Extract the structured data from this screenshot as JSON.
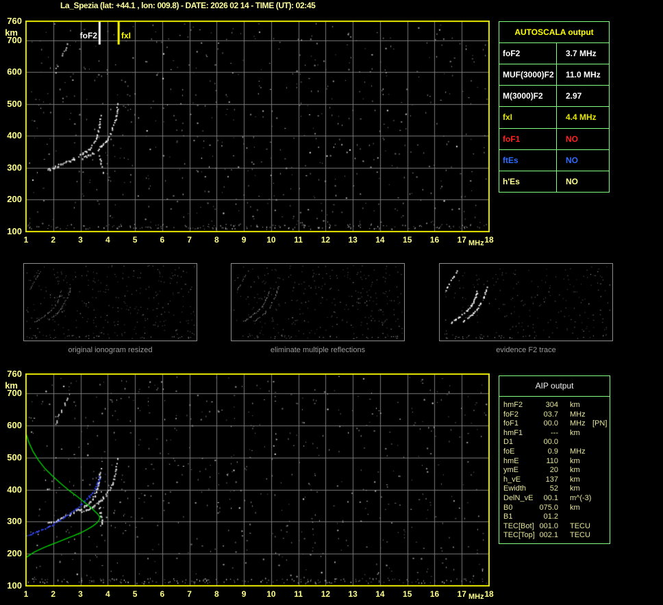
{
  "title": "La_Spezia (lat: +44.1 , lon: 009.8) - DATE: 2026 02 14 - TIME (UT): 02:45",
  "colors": {
    "plot_border": "#e8e800",
    "grid": "#7a7a7a",
    "axis_label": "#ffff8c",
    "table_border": "#80ff80",
    "trace_white": "#ffffff",
    "profile_green": "#00d400",
    "restored_blue": "#2a3ce8",
    "caption_gray": "#9c9c9c"
  },
  "axes": {
    "x_ticks": [
      "1",
      "2",
      "3",
      "4",
      "5",
      "6",
      "7",
      "8",
      "9",
      "10",
      "11",
      "12",
      "13",
      "14",
      "15",
      "16",
      "17",
      "18"
    ],
    "x_unit": "MHz",
    "y_ticks": [
      "760",
      "700",
      "600",
      "500",
      "400",
      "300",
      "200",
      "100"
    ],
    "y_values": [
      760,
      700,
      600,
      500,
      400,
      300,
      200,
      100
    ],
    "y_unit": "km",
    "x_range": [
      1,
      18
    ],
    "y_range": [
      100,
      760
    ]
  },
  "autoscala": {
    "header": "AUTOSCALA output",
    "rows": [
      {
        "label": "foF2",
        "value": "3.7 MHz",
        "color": "#ffffff"
      },
      {
        "label": "MUF(3000)F2",
        "value": "11.0 MHz",
        "color": "#ffffff"
      },
      {
        "label": "M(3000)F2",
        "value": "2.97",
        "color": "#ffffff"
      },
      {
        "label": "fxI",
        "value": "4.4 MHz",
        "color": "#e6e600"
      },
      {
        "label": "foF1",
        "value": "NO",
        "color": "#ff2222"
      },
      {
        "label": "ftEs",
        "value": "NO",
        "color": "#2e6bff"
      },
      {
        "label": "h'Es",
        "value": "NO",
        "color": "#ffff8c"
      }
    ]
  },
  "thumbnails": [
    {
      "caption": "original ionogram resized"
    },
    {
      "caption": "eliminate multiple reflections"
    },
    {
      "caption": "evidence F2 trace"
    }
  ],
  "aip": {
    "header": "AIP output",
    "rows": [
      {
        "label": "hmF2",
        "value": "304",
        "unit": "km",
        "note": ""
      },
      {
        "label": "foF2",
        "value": "03.7",
        "unit": "MHz",
        "note": ""
      },
      {
        "label": "foF1",
        "value": "00.0",
        "unit": "MHz",
        "note": "[PN]"
      },
      {
        "label": "hmF1",
        "value": "---",
        "unit": "km",
        "note": ""
      },
      {
        "label": "D1",
        "value": "00.0",
        "unit": "",
        "note": ""
      },
      {
        "label": "foE",
        "value": "0.9",
        "unit": "MHz",
        "note": ""
      },
      {
        "label": "hmE",
        "value": "110",
        "unit": "km",
        "note": ""
      },
      {
        "label": "ymE",
        "value": "20",
        "unit": "km",
        "note": ""
      },
      {
        "label": "h_vE",
        "value": "137",
        "unit": "km",
        "note": ""
      },
      {
        "label": "Ewidth",
        "value": "52",
        "unit": "km",
        "note": ""
      },
      {
        "label": "DelN_vE",
        "value": "00.1",
        "unit": "m^(-3)",
        "note": ""
      },
      {
        "label": "B0",
        "value": "075.0",
        "unit": "km",
        "note": ""
      },
      {
        "label": "B1",
        "value": "01.2",
        "unit": "",
        "note": ""
      },
      {
        "label": "TEC[Bot]",
        "value": "001.0",
        "unit": "TECU",
        "note": ""
      },
      {
        "label": "TEC[Top]",
        "value": "002.1",
        "unit": "TECU",
        "note": ""
      }
    ]
  },
  "chart_data": [
    {
      "id": "ionogram-top",
      "type": "scatter",
      "title": "",
      "xlabel": "MHz",
      "ylabel": "km",
      "xlim": [
        1,
        18
      ],
      "ylim": [
        100,
        760
      ],
      "grid": true,
      "annotations": [
        {
          "label": "foF2",
          "x": 3.7,
          "color": "#ffffff"
        },
        {
          "label": "fxI",
          "x": 4.4,
          "color": "#ffff00"
        }
      ],
      "series": [
        {
          "name": "O-trace",
          "color": "#ffffff",
          "style": "dots",
          "points": [
            [
              1.72,
              293
            ],
            [
              1.85,
              298
            ],
            [
              2.0,
              303
            ],
            [
              2.15,
              308
            ],
            [
              2.3,
              314
            ],
            [
              2.45,
              319
            ],
            [
              2.6,
              324
            ],
            [
              2.75,
              331
            ],
            [
              2.9,
              338
            ],
            [
              3.05,
              345
            ],
            [
              3.2,
              353
            ],
            [
              3.32,
              362
            ],
            [
              3.42,
              372
            ],
            [
              3.5,
              383
            ],
            [
              3.56,
              395
            ],
            [
              3.61,
              408
            ],
            [
              3.65,
              422
            ],
            [
              3.68,
              437
            ],
            [
              3.7,
              452
            ],
            [
              3.72,
              468
            ]
          ]
        },
        {
          "name": "X-trace",
          "color": "#ffffff",
          "style": "dots",
          "points": [
            [
              3.05,
              333
            ],
            [
              3.2,
              338
            ],
            [
              3.35,
              344
            ],
            [
              3.5,
              351
            ],
            [
              3.62,
              359
            ],
            [
              3.72,
              367
            ],
            [
              3.82,
              376
            ],
            [
              3.92,
              386
            ],
            [
              4.0,
              397
            ],
            [
              4.08,
              409
            ],
            [
              4.15,
              422
            ],
            [
              4.21,
              436
            ],
            [
              4.26,
              451
            ],
            [
              4.3,
              467
            ],
            [
              4.33,
              483
            ],
            [
              4.35,
              502
            ]
          ]
        },
        {
          "name": "X-tail",
          "color": "#ffffff",
          "style": "dots",
          "points": [
            [
              3.68,
              345
            ],
            [
              3.71,
              331
            ],
            [
              3.74,
              317
            ],
            [
              3.77,
              303
            ],
            [
              3.8,
              290
            ]
          ]
        },
        {
          "name": "second-hop-echo",
          "color": "#d8d8d8",
          "style": "sparse-dots",
          "points": [
            [
              2.0,
              592
            ],
            [
              2.1,
              612
            ],
            [
              2.2,
              633
            ],
            [
              2.32,
              653
            ],
            [
              2.42,
              672
            ],
            [
              2.52,
              690
            ]
          ]
        }
      ]
    },
    {
      "id": "ionogram-bottom",
      "type": "scatter",
      "title": "",
      "xlabel": "MHz",
      "ylabel": "km",
      "xlim": [
        1,
        18
      ],
      "ylim": [
        100,
        760
      ],
      "grid": true,
      "annotations": [],
      "series": [
        {
          "name": "O-trace",
          "color": "#ffffff",
          "style": "dots",
          "points": [
            [
              1.72,
              293
            ],
            [
              1.85,
              298
            ],
            [
              2.0,
              303
            ],
            [
              2.15,
              308
            ],
            [
              2.3,
              314
            ],
            [
              2.45,
              319
            ],
            [
              2.6,
              324
            ],
            [
              2.75,
              331
            ],
            [
              2.9,
              338
            ],
            [
              3.05,
              345
            ],
            [
              3.2,
              353
            ],
            [
              3.32,
              362
            ],
            [
              3.42,
              372
            ],
            [
              3.5,
              383
            ],
            [
              3.56,
              395
            ],
            [
              3.61,
              408
            ],
            [
              3.65,
              422
            ],
            [
              3.68,
              437
            ],
            [
              3.7,
              452
            ],
            [
              3.72,
              468
            ]
          ]
        },
        {
          "name": "X-trace",
          "color": "#ffffff",
          "style": "dots",
          "points": [
            [
              3.05,
              333
            ],
            [
              3.2,
              338
            ],
            [
              3.35,
              344
            ],
            [
              3.5,
              351
            ],
            [
              3.62,
              359
            ],
            [
              3.72,
              367
            ],
            [
              3.82,
              376
            ],
            [
              3.92,
              386
            ],
            [
              4.0,
              397
            ],
            [
              4.08,
              409
            ],
            [
              4.15,
              422
            ],
            [
              4.21,
              436
            ],
            [
              4.26,
              451
            ],
            [
              4.3,
              467
            ],
            [
              4.33,
              483
            ],
            [
              4.35,
              502
            ]
          ]
        },
        {
          "name": "X-tail",
          "color": "#ffffff",
          "style": "dots",
          "points": [
            [
              3.68,
              345
            ],
            [
              3.71,
              331
            ],
            [
              3.74,
              317
            ],
            [
              3.77,
              303
            ],
            [
              3.8,
              290
            ]
          ]
        },
        {
          "name": "second-hop-echo",
          "color": "#d8d8d8",
          "style": "sparse-dots",
          "points": [
            [
              2.0,
              592
            ],
            [
              2.1,
              612
            ],
            [
              2.2,
              633
            ],
            [
              2.32,
              653
            ],
            [
              2.42,
              672
            ],
            [
              2.52,
              690
            ]
          ]
        },
        {
          "name": "restored-trace",
          "color": "#2a3ce8",
          "style": "blue-dots",
          "points": [
            [
              1.0,
              259
            ],
            [
              1.2,
              264
            ],
            [
              1.4,
              270
            ],
            [
              1.6,
              277
            ],
            [
              1.8,
              285
            ],
            [
              2.0,
              294
            ],
            [
              2.2,
              304
            ],
            [
              2.4,
              315
            ],
            [
              2.6,
              327
            ],
            [
              2.8,
              340
            ],
            [
              3.0,
              354
            ],
            [
              3.15,
              366
            ],
            [
              3.3,
              379
            ],
            [
              3.42,
              392
            ],
            [
              3.52,
              405
            ],
            [
              3.6,
              418
            ],
            [
              3.65,
              430
            ],
            [
              3.68,
              440
            ]
          ]
        },
        {
          "name": "electron-density-profile",
          "color": "#00d400",
          "style": "line",
          "points": [
            [
              1.0,
              575
            ],
            [
              1.1,
              548
            ],
            [
              1.25,
              520
            ],
            [
              1.45,
              492
            ],
            [
              1.7,
              465
            ],
            [
              2.0,
              440
            ],
            [
              2.3,
              417
            ],
            [
              2.6,
              396
            ],
            [
              2.9,
              377
            ],
            [
              3.15,
              360
            ],
            [
              3.37,
              345
            ],
            [
              3.52,
              333
            ],
            [
              3.63,
              324
            ],
            [
              3.69,
              317
            ],
            [
              3.71,
              312
            ],
            [
              3.69,
              306
            ],
            [
              3.6,
              296
            ],
            [
              3.45,
              286
            ],
            [
              3.25,
              276
            ],
            [
              3.0,
              265
            ],
            [
              2.72,
              255
            ],
            [
              2.42,
              245
            ],
            [
              2.12,
              235
            ],
            [
              1.82,
              225
            ],
            [
              1.55,
              215
            ],
            [
              1.32,
              206
            ],
            [
              1.15,
              197
            ],
            [
              1.05,
              191
            ],
            [
              1.0,
              188
            ]
          ]
        }
      ]
    }
  ],
  "thumb_traces": {
    "o": [
      [
        16,
        85
      ],
      [
        22,
        81
      ],
      [
        28,
        77
      ],
      [
        34,
        72
      ],
      [
        40,
        67
      ],
      [
        45,
        61
      ],
      [
        49,
        54
      ],
      [
        52,
        47
      ],
      [
        54,
        40
      ]
    ],
    "x": [
      [
        34,
        83
      ],
      [
        41,
        78
      ],
      [
        48,
        72
      ],
      [
        54,
        65
      ],
      [
        59,
        57
      ],
      [
        63,
        49
      ],
      [
        66,
        41
      ],
      [
        68,
        33
      ]
    ],
    "echo": [
      [
        8,
        38
      ],
      [
        12,
        31
      ],
      [
        16,
        24
      ],
      [
        20,
        17
      ],
      [
        24,
        10
      ]
    ]
  },
  "noise": {
    "plot_dots": 640,
    "band_dots": 170,
    "thumb_dots": [
      300,
      300,
      220
    ],
    "thumb_brightness": [
      185,
      200,
      255
    ],
    "thumb_dot_size": [
      1,
      1,
      2
    ],
    "seeds": [
      101,
      202,
      303,
      404,
      505
    ]
  }
}
